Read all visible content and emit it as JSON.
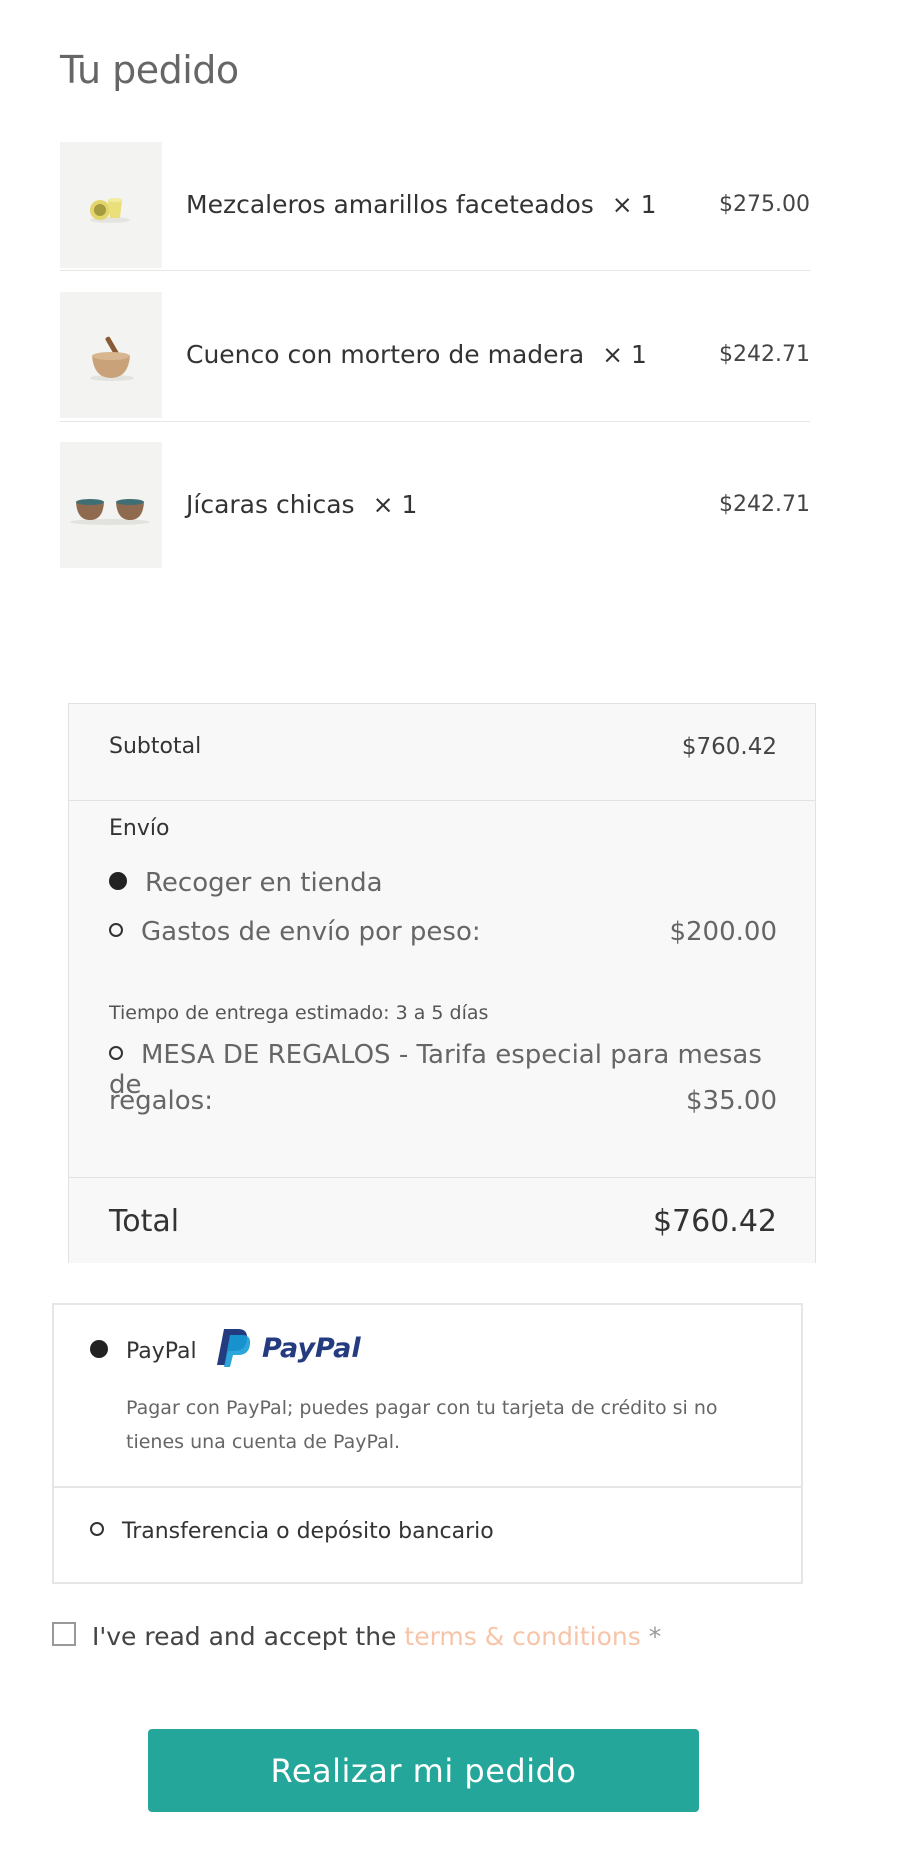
{
  "page_title": "Tu pedido",
  "items": [
    {
      "name": "Mezcaleros amarillos faceteados",
      "qty": "× 1",
      "price": "$275.00",
      "image_icon": "yellow-mezcal-cups-image"
    },
    {
      "name": "Cuenco con mortero de madera",
      "qty": "× 1",
      "price": "$242.71",
      "image_icon": "mortar-bowl-image"
    },
    {
      "name": "Jícaras chicas",
      "qty": "× 1",
      "price": "$242.71",
      "image_icon": "small-cups-image"
    }
  ],
  "totals": {
    "subtotal_label": "Subtotal",
    "subtotal_value": "$760.42",
    "shipping_label": "Envío",
    "shipping_options": [
      {
        "label": "Recoger en tienda",
        "price": "",
        "selected": true
      },
      {
        "label": "Gastos de envío por peso:",
        "price": "$200.00",
        "selected": false
      },
      {
        "label_line1": "MESA DE REGALOS - Tarifa especial para mesas de",
        "label_line2": "regalos:",
        "price": "$35.00",
        "selected": false
      }
    ],
    "delivery_note": "Tiempo de entrega estimado: 3 a 5 días",
    "total_label": "Total",
    "total_value": "$760.42"
  },
  "payment": {
    "paypal_label": "PayPal",
    "paypal_logo_text": "PayPal",
    "paypal_description": "Pagar con PayPal; puedes pagar con tu tarjeta de crédito si no tienes una cuenta de PayPal.",
    "bank_label": "Transferencia o depósito bancario"
  },
  "terms": {
    "prefix": "I've read and accept the ",
    "link": "terms & conditions",
    "required_mark": " *"
  },
  "place_order_label": "Realizar mi pedido",
  "colors": {
    "button": "#25a69a",
    "terms_link": "#f7c4a8",
    "paypal_dark_blue": "#253b80",
    "paypal_light_blue": "#179bd7"
  }
}
